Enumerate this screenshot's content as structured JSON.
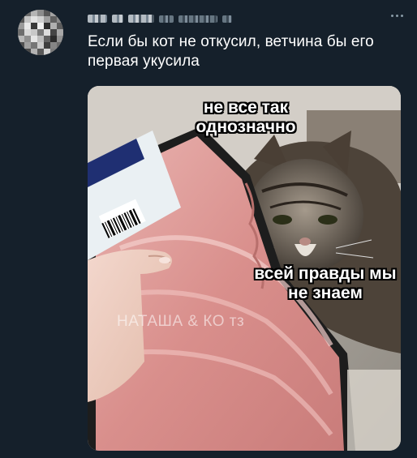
{
  "tweet": {
    "text": "Если бы кот не откусил, ветчина бы его первая укусила",
    "author_name_blurred": true,
    "author_handle_blurred": true
  },
  "media": {
    "caption_top": "не все так однозначно",
    "caption_middle": "всей правды мы не знаем",
    "watermark": "НАТАША & КО тз"
  },
  "icons": {
    "more": "more-horizontal-icon"
  },
  "colors": {
    "background": "#15202b",
    "text": "#ffffff",
    "secondary": "#8899a6"
  }
}
